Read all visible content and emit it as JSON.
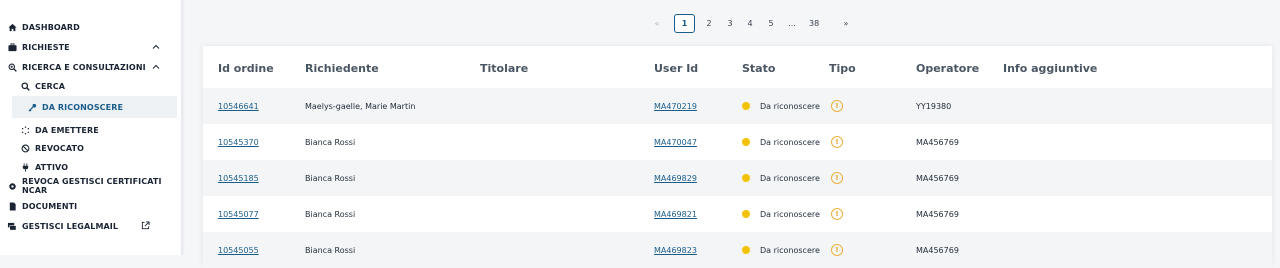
{
  "sidebar": {
    "items": [
      {
        "label": "DASHBOARD",
        "icon": "home-icon"
      },
      {
        "label": "RICHIESTE",
        "icon": "briefcase-icon"
      },
      {
        "label": "RICERCA E CONSULTAZIONI",
        "icon": "search-zoom-icon"
      },
      {
        "label": "CERCA",
        "icon": "search-icon"
      },
      {
        "label": "DA RICONOSCERE",
        "icon": "key-icon"
      },
      {
        "label": "DA EMETTERE",
        "icon": "loading-icon"
      },
      {
        "label": "REVOCATO",
        "icon": "ban-icon"
      },
      {
        "label": "ATTIVO",
        "icon": "plug-icon"
      },
      {
        "label": "REVOCA GESTISCI CERTIFICATI NCAR",
        "icon": "gear-icon"
      },
      {
        "label": "DOCUMENTI",
        "icon": "document-icon"
      },
      {
        "label": "GESTISCI LEGALMAIL",
        "icon": "mail-stack-icon"
      }
    ]
  },
  "pagination": {
    "prev": "«",
    "pages": [
      "1",
      "2",
      "3",
      "4",
      "5"
    ],
    "ellipsis": "...",
    "last": "38",
    "next": "»",
    "current": "1"
  },
  "table": {
    "headers": [
      "Id ordine",
      "Richiedente",
      "Titolare",
      "User Id",
      "Stato",
      "Tipo",
      "Operatore",
      "Info aggiuntive"
    ],
    "rows": [
      {
        "id": "10546641",
        "richiedente": "Maelys-gaelle, Marie Martin",
        "titolare": "",
        "user_id": "MA470219",
        "stato": "Da riconoscere",
        "operatore": "YY19380"
      },
      {
        "id": "10545370",
        "richiedente": "Bianca Rossi",
        "titolare": "",
        "user_id": "MA470047",
        "stato": "Da riconoscere",
        "operatore": "MA456769"
      },
      {
        "id": "10545185",
        "richiedente": "Bianca Rossi",
        "titolare": "",
        "user_id": "MA469829",
        "stato": "Da riconoscere",
        "operatore": "MA456769"
      },
      {
        "id": "10545077",
        "richiedente": "Bianca Rossi",
        "titolare": "",
        "user_id": "MA469821",
        "stato": "Da riconoscere",
        "operatore": "MA456769"
      },
      {
        "id": "10545055",
        "richiedente": "Bianca Rossi",
        "titolare": "",
        "user_id": "MA469823",
        "stato": "Da riconoscere",
        "operatore": "MA456769"
      }
    ]
  },
  "colors": {
    "accent": "#1b5e8c",
    "status_pending": "#f2c200",
    "tipo_icon": "#f0b040"
  },
  "tipo_icon": "badge-icon"
}
